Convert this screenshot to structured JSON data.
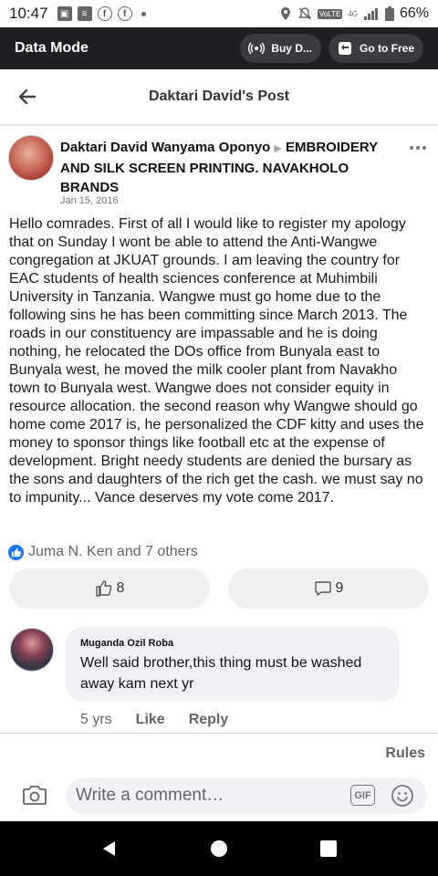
{
  "status_bar": {
    "time": "10:47",
    "volte": "VoLTE",
    "network": "4G",
    "battery": "66%"
  },
  "data_bar": {
    "title": "Data Mode",
    "buy_label": "Buy D...",
    "free_label": "Go to Free"
  },
  "header": {
    "title": "Daktari David's Post"
  },
  "post": {
    "author": "Daktari David Wanyama Oponyo",
    "page_name": "EMBROIDERY AND SILK SCREEN PRINTING. NAVAKHOLO BRANDS",
    "date": "Jan 15, 2016",
    "body": "Hello comrades. First of all I would like to register my apology that on Sunday I wont be able to attend the Anti-Wangwe congregation at JKUAT grounds. I am leaving the country for EAC students of health sciences conference at Muhimbili University in Tanzania. Wangwe must go home due to the following sins he has been committing since March 2013. The roads in our constituency are impassable and he is doing nothing, he relocated the DOs office from Bunyala east to Bunyala west, he moved the milk cooler plant from Navakho town to Bunyala west. Wangwe does not consider equity in resource allocation. the second reason why Wangwe should go home come 2017 is, he personalized the CDF kitty and uses the money to sponsor things like football etc at the expense of development. Bright needy students are denied the bursary as the sons and daughters of the rich get the cash. we must say no to impunity... Vance deserves my vote come 2017.",
    "reactions_text": "Juma N. Ken and 7 others",
    "like_count": "8",
    "comment_count": "9"
  },
  "comment": {
    "author": "Muganda Ozil Roba",
    "text": "Well said brother,this thing must be washed away kam next yr",
    "age": "5 yrs",
    "like_label": "Like",
    "reply_label": "Reply"
  },
  "rules_label": "Rules",
  "composer": {
    "placeholder": "Write a comment…",
    "gif_label": "GIF"
  },
  "colors": {
    "accent": "#1877f2",
    "data_bar_bg": "#1d1f23",
    "bubble_bg": "#f0f2f5"
  }
}
